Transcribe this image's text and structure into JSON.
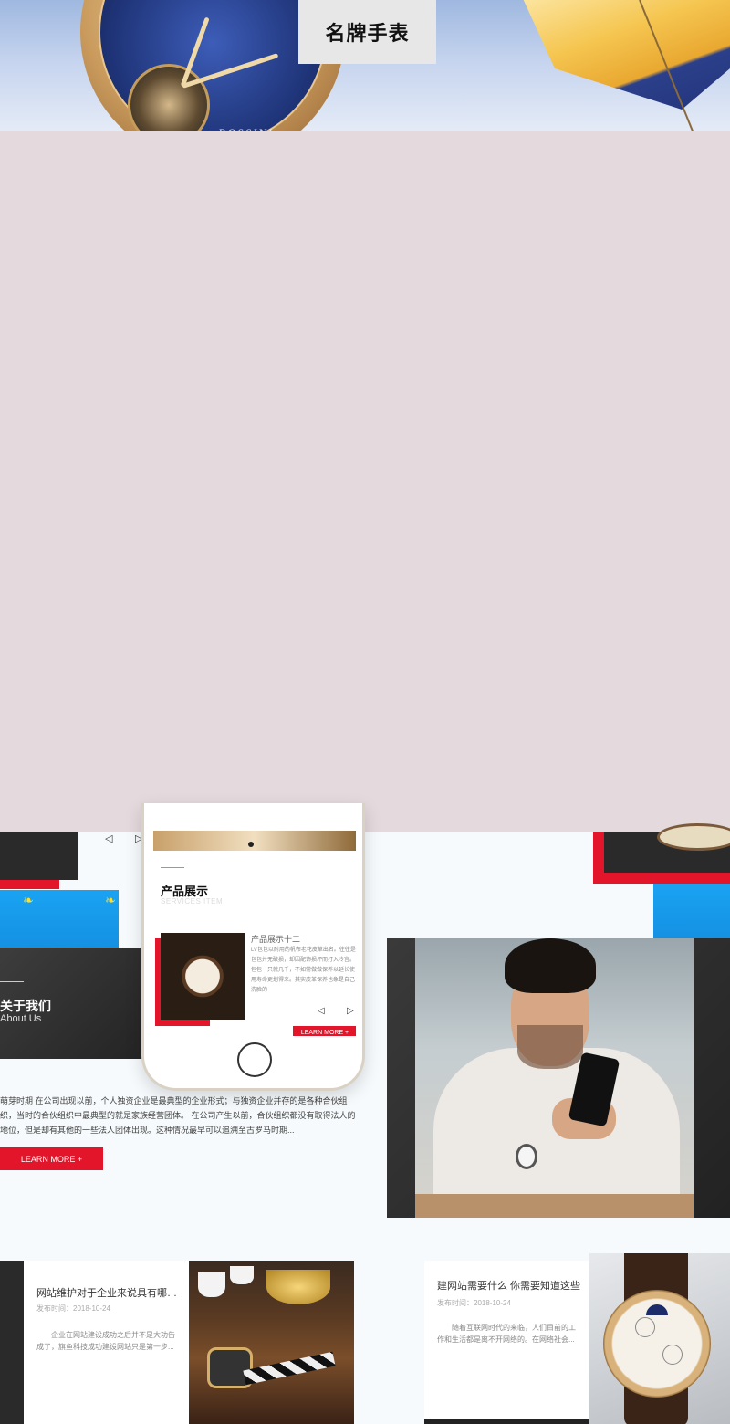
{
  "banner": {
    "title": "名牌手表",
    "watch_brand": "ROSSINI"
  },
  "nav_arrows": {
    "prev": "◁",
    "next": "▷"
  },
  "phone": {
    "section_title": "产品展示",
    "section_subtitle": "SERVICES ITEM",
    "product_name": "产品展示十二",
    "product_desc": "LV包包以耐用的帆布老花皮革出名。往往是包包并无破损，却因配饰损坏而打入冷宫。包包一只就几千，不如常做做保养以延长使用寿命更划得来。其实皮革保养也象是自己洗脸的",
    "learn_more": "LEARN MORE +"
  },
  "about": {
    "title": "关于我们",
    "subtitle": "About Us",
    "text": "萌芽时期 在公司出现以前，个人独资企业是最典型的企业形式；与独资企业并存的是各种合伙组织，当时的合伙组织中最典型的就是家族经营团体。 在公司产生以前，合伙组织都没有取得法人的地位，但是却有其他的一些法人团体出现。这种情况最早可以追溯至古罗马时期...",
    "learn_more": "LEARN MORE +"
  },
  "news": [
    {
      "title": "网站维护对于企业来说具有哪些...",
      "date": "发布时间：2018-10-24",
      "desc": "企业在网站建设成功之后并不是大功告成了，旗鱼科技成功建设网站只是第一步..."
    },
    {
      "title": "建网站需要什么 你需要知道这些",
      "date": "发布时间：2018-10-24",
      "desc": "随着互联网时代的来临，人们目前的工作和生活都是离不开网络的。在网络社会..."
    }
  ],
  "colors": {
    "accent_red": "#e3152a",
    "accent_blue": "#1aa3f2",
    "blank_area": "#e4d9dd"
  }
}
